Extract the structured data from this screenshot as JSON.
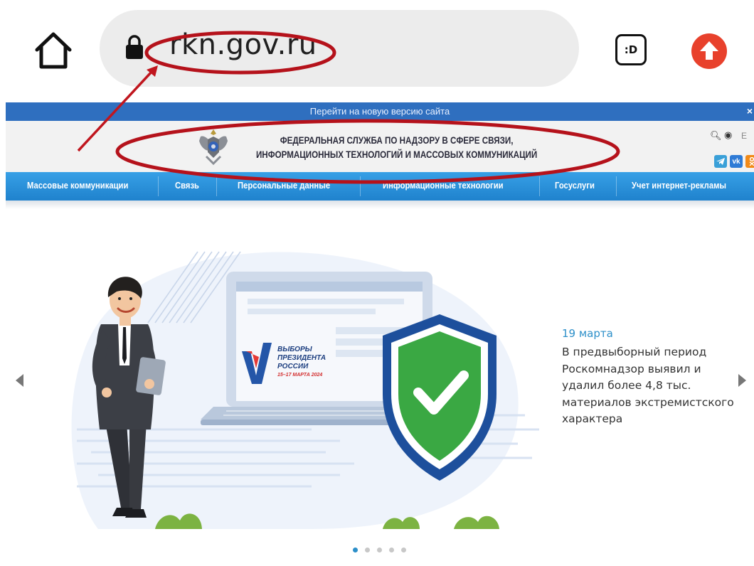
{
  "browser": {
    "url": "rkn.gov.ru",
    "extension_label": ":D",
    "icons": [
      "home-icon",
      "lock-icon",
      "extension-icon",
      "update-icon"
    ],
    "colors": {
      "urlbar_bg": "#ececec",
      "update_red": "#e8412c",
      "annotation_red": "#b5121b"
    }
  },
  "site": {
    "topbar": {
      "link": "Перейти на новую версию сайта",
      "close": "×"
    },
    "header": {
      "org_line1": "ФЕДЕРАЛЬНАЯ СЛУЖБА ПО НАДЗОРУ В СФЕРЕ СВЯЗИ,",
      "org_line2": "ИНФОРМАЦИОННЫХ ТЕХНОЛОГИЙ И МАССОВЫХ КОММУНИКАЦИЙ",
      "lang": "E",
      "social": [
        "telegram-icon",
        "vk-icon",
        "ok-icon"
      ],
      "vk_label": "vk"
    },
    "nav": {
      "items": [
        "Массовые коммуникации",
        "Связь",
        "Персональные данные",
        "Информационные технологии",
        "Госуслуги",
        "Учет интернет-рекламы"
      ]
    },
    "slider": {
      "ballot": {
        "line1": "ВЫБОРЫ",
        "line2": "ПРЕЗИДЕНТА",
        "line3": "РОССИИ",
        "line4": "15–17 МАРТА 2024"
      },
      "news": {
        "date": "19 марта",
        "text": "В предвыборный период Роскомнадзор выявил и удалил более 4,8 тыс. материалов экстремистского характера"
      },
      "dots_total": 5,
      "active_dot": 1
    },
    "colors": {
      "topbar": "#2f6fbf",
      "nav": "#2a8fd9",
      "accent_date": "#2c8fc9",
      "shield_green": "#3aa843",
      "shield_blue": "#1d4f9c"
    }
  }
}
